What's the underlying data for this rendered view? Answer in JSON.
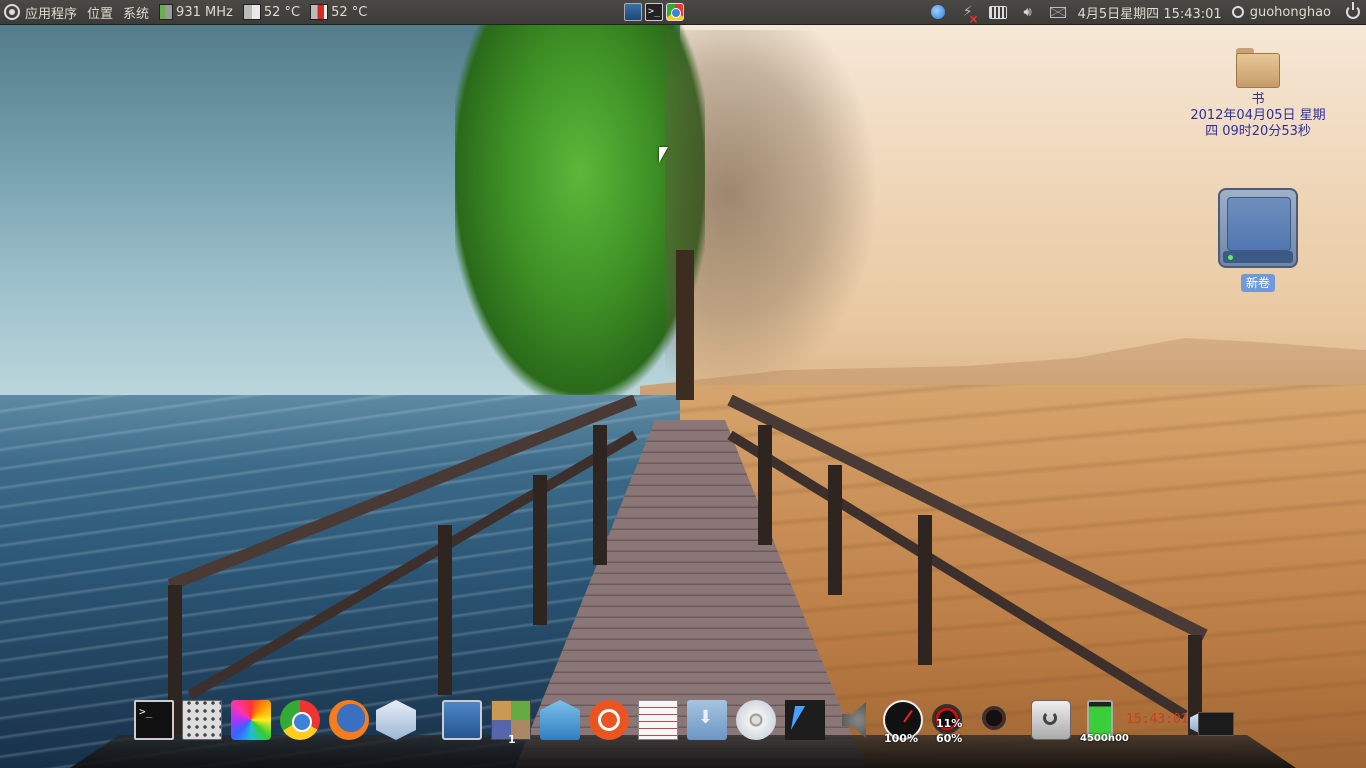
{
  "top_panel": {
    "menu_apps": "应用程序",
    "menu_places": "位置",
    "menu_system": "系统",
    "cpu_freq": "931 MHz",
    "temp1": "52 °C",
    "temp2": "52 °C",
    "datetime": "4月5日星期四 15:43:01",
    "username": "guohonghao"
  },
  "desktop": {
    "folder_label": "书",
    "folder_date": "2012年04月05日 星期四 09时20分53秒",
    "drive_label": "新卷"
  },
  "dock": {
    "photos_count": "1",
    "cpu_gauge": "100%",
    "mem_top": "11%",
    "mem_bottom": "60%",
    "battery_label": "4500h00",
    "clock": "15:43:01"
  },
  "colors": {
    "panel_bg": "#3c3b37",
    "desktop_label_text": "#2f2f9a",
    "drive_label_bg": "#6d9ad8",
    "clock_text": "#c8411b"
  },
  "icons": [
    "ubuntu-logo-icon",
    "cpu-chip-icon",
    "temperature-icon",
    "screen-icon",
    "terminal-icon",
    "chrome-icon",
    "bird-messenger-icon",
    "network-disconnected-icon",
    "keyboard-icon",
    "volume-icon",
    "mail-icon",
    "user-icon",
    "power-icon"
  ]
}
